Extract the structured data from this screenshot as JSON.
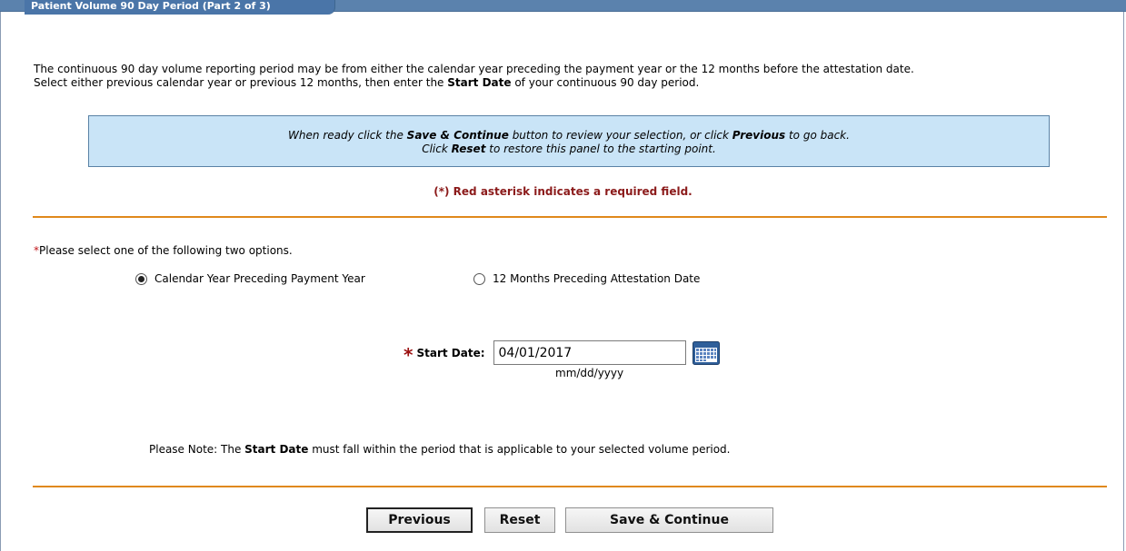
{
  "header": {
    "title": "Patient Volume 90 Day Period (Part 2 of 3)"
  },
  "intro": {
    "line1": "The continuous 90 day volume reporting period may be from either the calendar year preceding the payment year or the 12 months before the attestation date.",
    "line2_prefix": "Select either previous calendar year or previous 12 months, then enter the ",
    "line2_bold": "Start Date",
    "line2_suffix": " of your continuous 90 day period."
  },
  "info_box": {
    "l1_a": "When ready click the ",
    "l1_b": "Save & Continue",
    "l1_c": " button to review your selection, or click ",
    "l1_d": "Previous",
    "l1_e": " to go back.",
    "l2_a": "Click ",
    "l2_b": "Reset",
    "l2_c": " to restore this panel to the starting point."
  },
  "required_note": "(*) Red asterisk indicates a required field.",
  "options": {
    "asterisk": "*",
    "prompt": "Please select one of the following two options.",
    "opt1_label": "Calendar Year Preceding Payment Year",
    "opt1_selected": true,
    "opt2_label": "12 Months Preceding Attestation Date",
    "opt2_selected": false
  },
  "start_date": {
    "asterisk": "*",
    "label": "Start Date:",
    "value": "04/01/2017",
    "format": "mm/dd/yyyy",
    "icon": "calendar-icon"
  },
  "note": {
    "prefix": "Please Note: The ",
    "bold": "Start Date",
    "suffix": " must fall within the period that is applicable to your selected volume period."
  },
  "buttons": {
    "previous": "Previous",
    "reset": "Reset",
    "save": "Save & Continue"
  },
  "colors": {
    "header": "#4a75a8",
    "info_box_bg": "#c9e4f7",
    "rule": "#e0891b",
    "required": "#8b1a1a"
  }
}
